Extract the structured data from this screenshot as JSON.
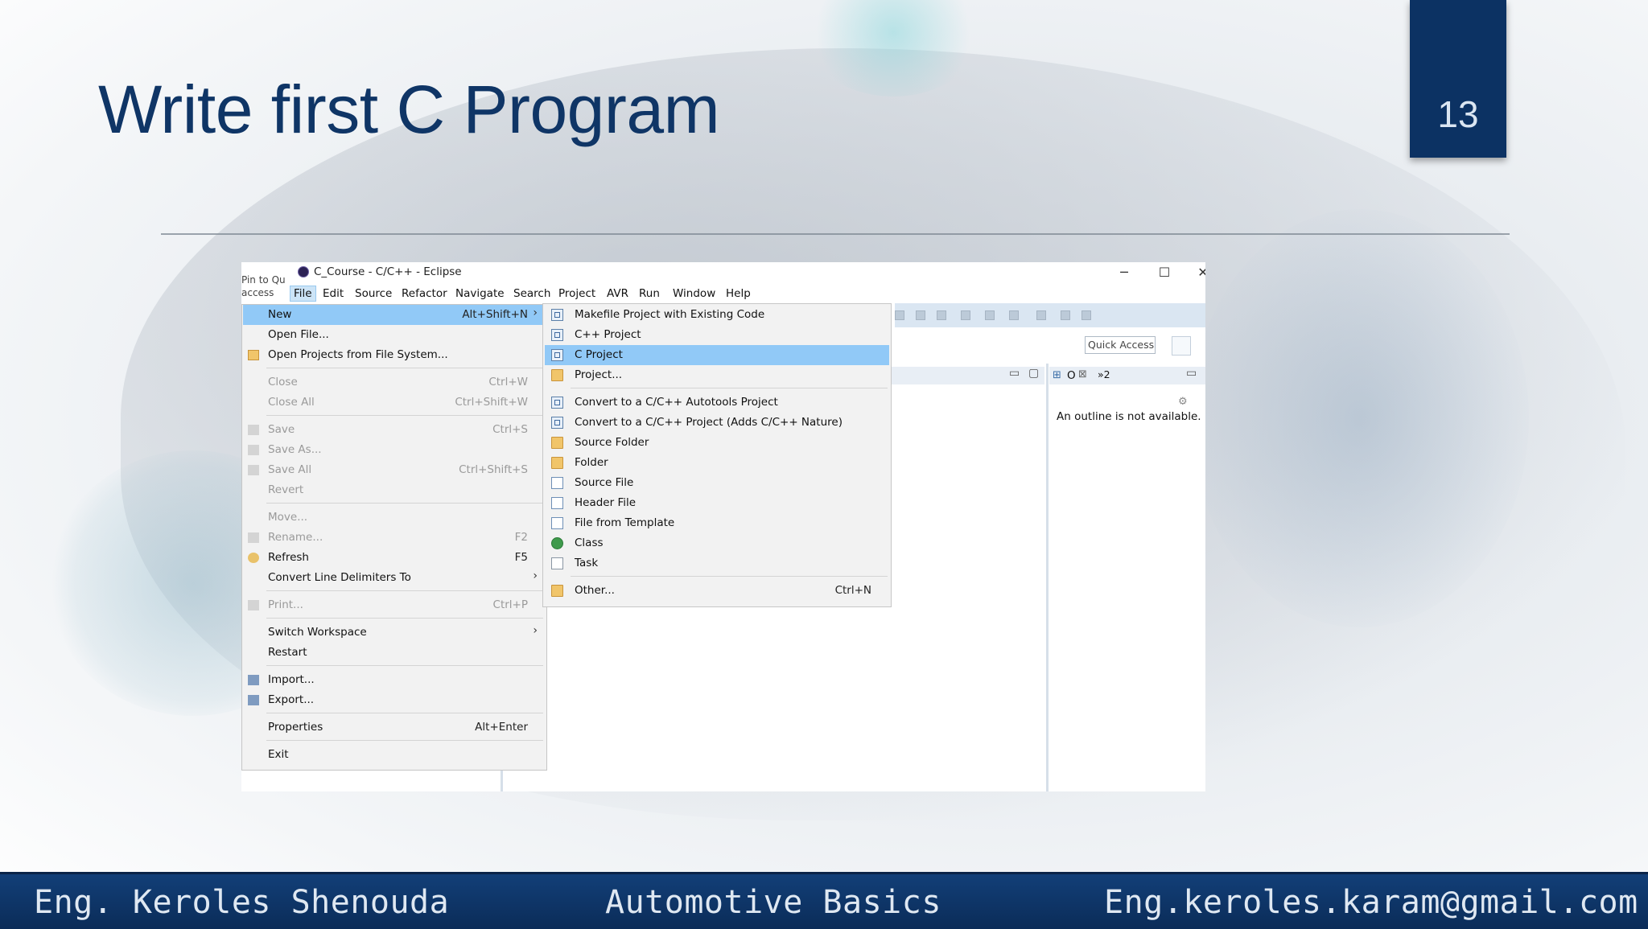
{
  "slide": {
    "title": "Write first C Program",
    "page_number": "13"
  },
  "window": {
    "title": "C_Course - C/C++ - Eclipse",
    "pin_text": "Pin to Qu access",
    "controls": {
      "minimize": "─",
      "maximize": "☐",
      "close": "✕"
    },
    "menu": [
      "File",
      "Edit",
      "Source",
      "Refactor",
      "Navigate",
      "Search",
      "Project",
      "AVR",
      "Run",
      "Window",
      "Help"
    ],
    "active_menu": "File",
    "quick_access": "Quick Access",
    "outline_tab": "O",
    "outline_extra": "»2",
    "outline_message": "An outline is not available."
  },
  "file_menu": [
    {
      "label": "New",
      "shortcut": "Alt+Shift+N",
      "arrow": "›",
      "highlighted": true
    },
    {
      "label": "Open File..."
    },
    {
      "label": "Open Projects from File System...",
      "icon": "folder-icon"
    },
    {
      "label": "Close",
      "shortcut": "Ctrl+W",
      "disabled": true
    },
    {
      "label": "Close All",
      "shortcut": "Ctrl+Shift+W",
      "disabled": true
    },
    {
      "label": "Save",
      "shortcut": "Ctrl+S",
      "disabled": true
    },
    {
      "label": "Save As...",
      "disabled": true
    },
    {
      "label": "Save All",
      "shortcut": "Ctrl+Shift+S",
      "disabled": true
    },
    {
      "label": "Revert",
      "disabled": true
    },
    {
      "label": "Move...",
      "disabled": true
    },
    {
      "label": "Rename...",
      "shortcut": "F2",
      "disabled": true
    },
    {
      "label": "Refresh",
      "shortcut": "F5"
    },
    {
      "label": "Convert Line Delimiters To",
      "arrow": "›"
    },
    {
      "label": "Print...",
      "shortcut": "Ctrl+P",
      "disabled": true
    },
    {
      "label": "Switch Workspace",
      "arrow": "›"
    },
    {
      "label": "Restart"
    },
    {
      "label": "Import..."
    },
    {
      "label": "Export..."
    },
    {
      "label": "Properties",
      "shortcut": "Alt+Enter"
    },
    {
      "label": "Exit"
    }
  ],
  "new_submenu": [
    {
      "label": "Makefile Project with Existing Code",
      "icon": "project-icon"
    },
    {
      "label": "C++ Project",
      "icon": "project-icon"
    },
    {
      "label": "C Project",
      "icon": "project-icon",
      "highlighted": true
    },
    {
      "label": "Project...",
      "icon": "folder-icon"
    },
    {
      "label": "Convert to a C/C++ Autotools Project",
      "icon": "project-icon"
    },
    {
      "label": "Convert to a C/C++ Project (Adds C/C++ Nature)",
      "icon": "project-icon"
    },
    {
      "label": "Source Folder",
      "icon": "folder-icon"
    },
    {
      "label": "Folder",
      "icon": "folder-icon"
    },
    {
      "label": "Source File",
      "icon": "file-icon"
    },
    {
      "label": "Header File",
      "icon": "file-icon"
    },
    {
      "label": "File from Template",
      "icon": "file-icon"
    },
    {
      "label": "Class",
      "icon": "class-icon"
    },
    {
      "label": "Task",
      "icon": "task-icon"
    },
    {
      "label": "Other...",
      "shortcut": "Ctrl+N",
      "icon": "folder-icon"
    }
  ],
  "footer": {
    "author": "Eng. Keroles Shenouda",
    "course": "Automotive Basics",
    "email": "Eng.keroles.karam@gmail.com"
  },
  "colors": {
    "title": "#0f3566",
    "footer": "#0b2c58",
    "menu_highlight": "#91c9f7"
  }
}
